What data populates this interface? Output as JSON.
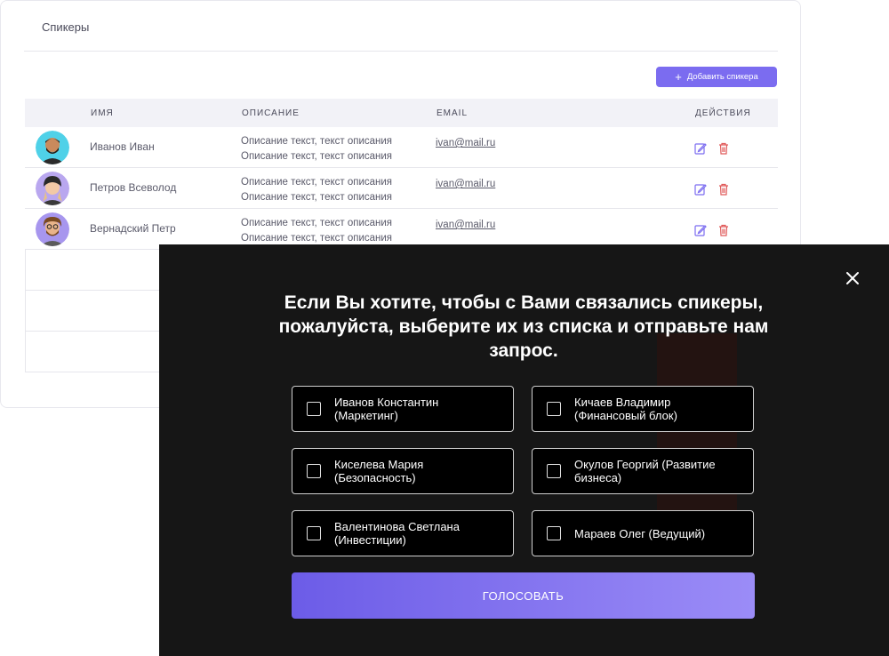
{
  "panel": {
    "title": "Спикеры",
    "add_button_label": "Добавить спикера"
  },
  "table": {
    "headers": {
      "name": "Имя",
      "description": "Описание",
      "email": "Email",
      "actions": "Действия"
    },
    "rows": [
      {
        "name": "Иванов Иван",
        "desc_line1": "Описание текст, текст описания",
        "desc_line2": "Описание текст, текст описания",
        "email": "ivan@mail.ru"
      },
      {
        "name": "Петров Всеволод",
        "desc_line1": "Описание текст, текст описания",
        "desc_line2": "Описание текст, текст описания",
        "email": "ivan@mail.ru"
      },
      {
        "name": "Вернадский Петр",
        "desc_line1": "Описание текст, текст описания",
        "desc_line2": "Описание текст, текст описания",
        "email": "ivan@mail.ru"
      }
    ]
  },
  "modal": {
    "title": "Если Вы хотите, чтобы с Вами связались спикеры, пожалуйста, выберите их из списка и отправьте нам запрос.",
    "options": [
      {
        "label": "Иванов Константин (Маркетинг)",
        "checked": false
      },
      {
        "label": "Кичаев Владимир (Финансовый блок)",
        "checked": false
      },
      {
        "label": "Киселева Мария (Безопасность)",
        "checked": false
      },
      {
        "label": "Окулов Георгий (Развитие бизнеса)",
        "checked": false
      },
      {
        "label": "Валентинова Светлана (Инвестиции)",
        "checked": false
      },
      {
        "label": "Мараев Олег (Ведущий)",
        "checked": false
      }
    ],
    "vote_button_label": "ГОЛОСОВАТЬ"
  },
  "colors": {
    "accent": "#7b6cf0",
    "modal_bg": "#161616",
    "edit_icon": "#7b6cf0",
    "delete_icon": "#e05a5a"
  },
  "icons": [
    "plus-icon",
    "avatar",
    "edit-icon",
    "delete-icon",
    "close-icon",
    "checkbox"
  ]
}
